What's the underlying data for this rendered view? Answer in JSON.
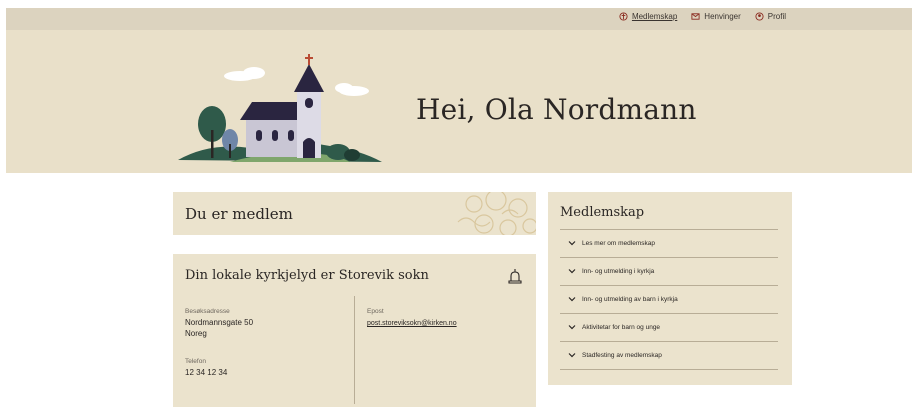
{
  "topnav": {
    "items": [
      {
        "label": "Medlemskap",
        "icon": "church-icon",
        "active": true
      },
      {
        "label": "Henvinger",
        "icon": "envelope-icon",
        "active": false
      },
      {
        "label": "Profil",
        "icon": "user-icon",
        "active": false
      }
    ]
  },
  "hero": {
    "greeting": "Hei, Ola Nordmann"
  },
  "member_card": {
    "title": "Du er medlem"
  },
  "local_card": {
    "title": "Din lokale kyrkjelyd er Storevik sokn",
    "address_label": "Besøksadresse",
    "address_line1": "Nordmannsgate 50",
    "address_line2": "Noreg",
    "phone_label": "Telefon",
    "phone": "12 34 12 34",
    "email_label": "Epost",
    "email": "post.storeviksokn@kirken.no"
  },
  "sidebar": {
    "title": "Medlemskap",
    "items": [
      "Les mer om medlemskap",
      "Inn- og utmelding i kyrkja",
      "Inn- og utmelding av barn i kyrkja",
      "Aktivitetar for barn og unge",
      "Stadfesting av medlemskap"
    ]
  },
  "colors": {
    "topbar": "#dcd3bf",
    "hero": "#e9e0c9",
    "card": "#ebe3cd",
    "accent": "#8a2a1f"
  }
}
